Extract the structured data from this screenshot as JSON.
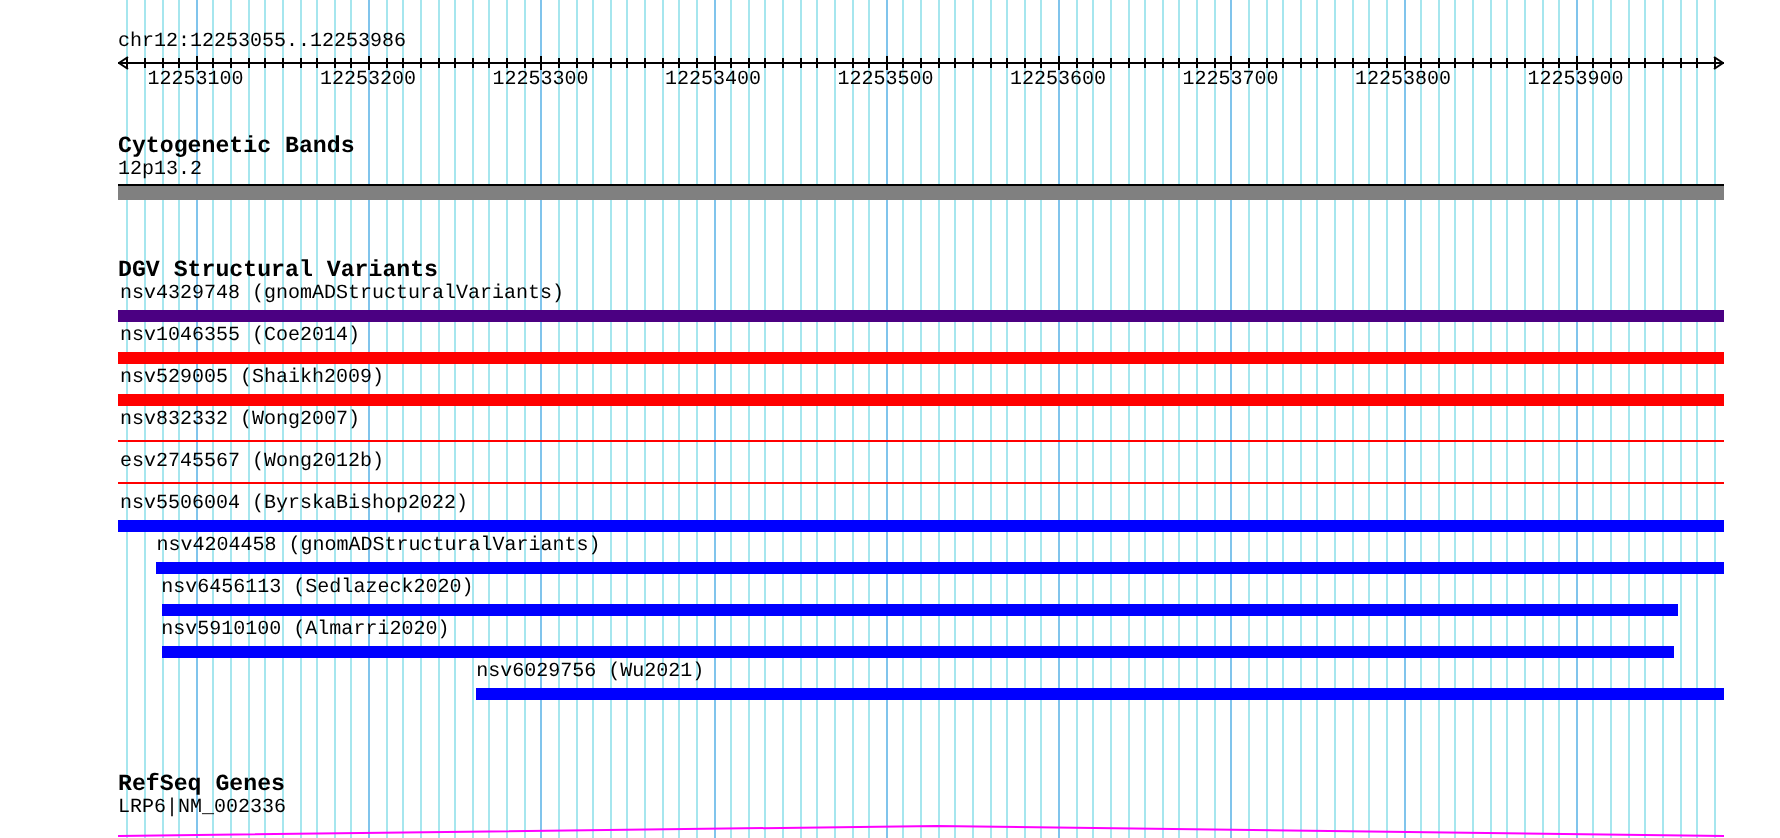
{
  "ruler": {
    "locus": "chr12:12253055..12253986",
    "tick_labels": [
      "12253100",
      "12253200",
      "12253300",
      "12253400",
      "12253500",
      "12253600",
      "12253700",
      "12253800",
      "12253900"
    ]
  },
  "tracks": [
    {
      "kind": "cytoband",
      "title": "Cytogenetic Bands",
      "features": [
        {
          "label": "12p13.2"
        }
      ]
    },
    {
      "kind": "variants",
      "title": "DGV Structural Variants",
      "features": [
        {
          "label": "nsv4329748 (gnomADStructuralVariants)",
          "kind": "thick",
          "color": "#4b0082"
        },
        {
          "label": "nsv1046355 (Coe2014)",
          "kind": "thick",
          "color": "#ff0000"
        },
        {
          "label": "nsv529005 (Shaikh2009)",
          "kind": "thick",
          "color": "#ff0000"
        },
        {
          "label": "nsv832332 (Wong2007)",
          "kind": "thin",
          "color": "#ff0000"
        },
        {
          "label": "esv2745567 (Wong2012b)",
          "kind": "thin",
          "color": "#ff0000"
        },
        {
          "label": "nsv5506004 (ByrskaBishop2022)",
          "kind": "thick",
          "color": "#0000ff"
        },
        {
          "label": "nsv4204458 (gnomADStructuralVariants)",
          "kind": "thick",
          "color": "#0000ff"
        },
        {
          "label": "nsv6456113 (Sedlazeck2020)",
          "kind": "thick",
          "color": "#0000ff"
        },
        {
          "label": "nsv5910100 (Almarri2020)",
          "kind": "thick",
          "color": "#0000ff"
        },
        {
          "label": "nsv6029756 (Wu2021)",
          "kind": "thick",
          "color": "#0000ff"
        }
      ]
    },
    {
      "kind": "genes",
      "title": "RefSeq Genes",
      "features": [
        {
          "label": "LRP6|NM_002336"
        }
      ]
    }
  ]
}
